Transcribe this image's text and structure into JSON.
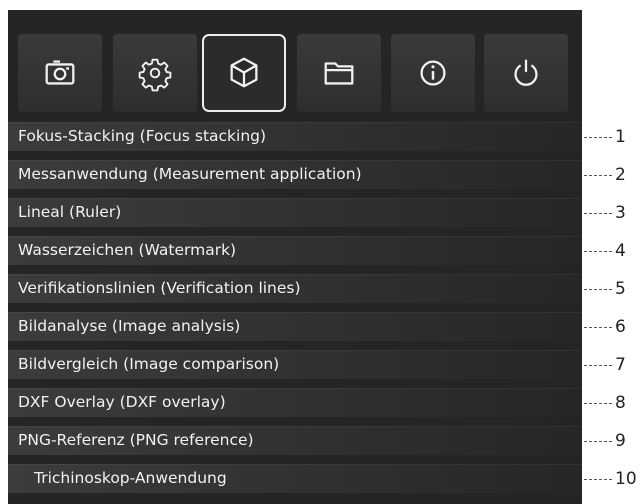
{
  "toolbar": {
    "buttons": [
      {
        "icon": "camera-icon",
        "active": false
      },
      {
        "icon": "gear-icon",
        "active": false
      },
      {
        "icon": "cube-icon",
        "active": true
      },
      {
        "icon": "folder-icon",
        "active": false
      },
      {
        "icon": "info-icon",
        "active": false
      },
      {
        "icon": "power-icon",
        "active": false
      }
    ]
  },
  "menu": {
    "items": [
      {
        "label": "Fokus-Stacking (Focus stacking)",
        "callout": "1"
      },
      {
        "label": "Messanwendung (Measurement application)",
        "callout": "2"
      },
      {
        "label": "Lineal (Ruler)",
        "callout": "3"
      },
      {
        "label": "Wasserzeichen (Watermark)",
        "callout": "4"
      },
      {
        "label": "Verifikationslinien (Verification lines)",
        "callout": "5"
      },
      {
        "label": "Bildanalyse (Image analysis)",
        "callout": "6"
      },
      {
        "label": "Bildvergleich (Image comparison)",
        "callout": "7"
      },
      {
        "label": "DXF Overlay (DXF overlay)",
        "callout": "8"
      },
      {
        "label": "PNG-Referenz (PNG reference)",
        "callout": "9"
      },
      {
        "label": "Trichinoskop-Anwendung",
        "callout": "10"
      }
    ]
  },
  "colors": {
    "panel_bg": "#252525",
    "row_bg": "#3c3c3c",
    "text": "#f2f2f2",
    "active_border": "#ececec",
    "callout_text": "#222222"
  }
}
